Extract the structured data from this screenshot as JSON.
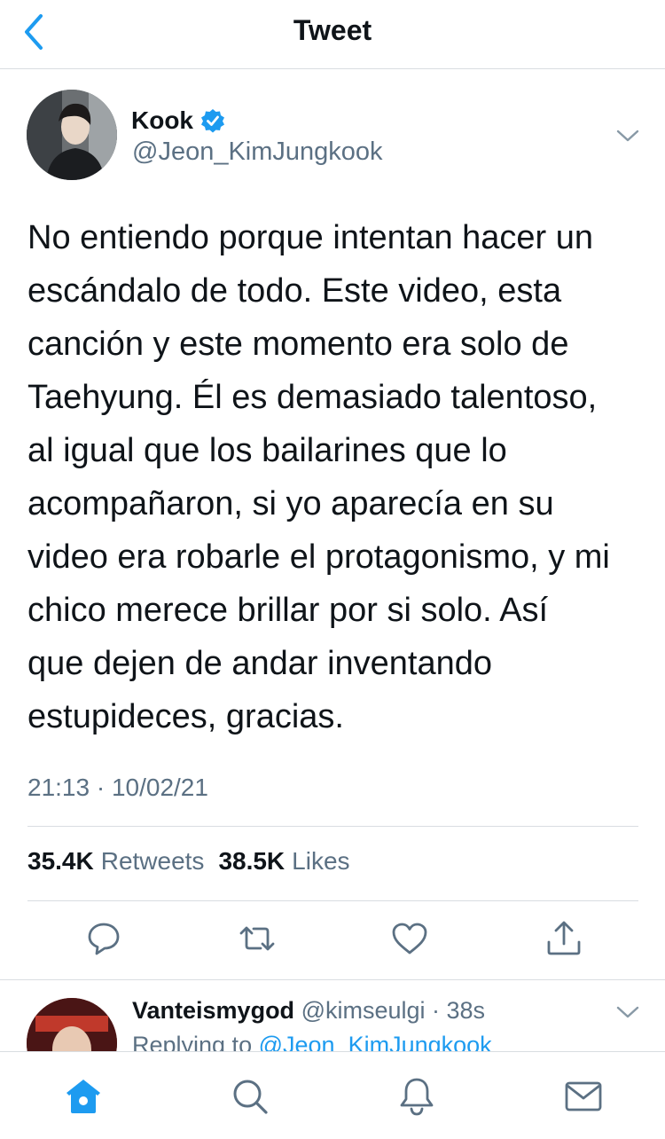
{
  "header": {
    "title": "Tweet"
  },
  "tweet": {
    "author_name": "Kook",
    "author_handle": "@Jeon_KimJungkook",
    "lines": [
      "No entiendo porque intentan hacer un",
      "escándalo de todo. Este video, esta",
      "canción y este momento era solo de",
      "Taehyung. Él es demasiado talentoso,",
      "al igual que los bailarines que lo",
      "acompañaron, si yo aparecía en su",
      "video era robarle el protagonismo, y mi",
      "chico merece brillar por si solo. Así",
      "que dejen de andar inventando",
      "estupideces, gracias."
    ],
    "timestamp": "21:13 · 10/02/21",
    "retweets_count": "35.4K",
    "retweets_label": "Retweets",
    "likes_count": "38.5K",
    "likes_label": "Likes"
  },
  "reply": {
    "name": "Vanteismygod",
    "handle_time": "@kimseulgi · 38s",
    "replying_prefix": "Replying to",
    "replying_mention": "@Jeon_KimJungkook"
  },
  "colors": {
    "accent": "#1d9bf0",
    "muted": "#5b7083",
    "text": "#0f1419",
    "divider": "#d9dde1"
  },
  "icons": [
    "back-arrow-icon",
    "verified-badge-icon",
    "chevron-down-icon",
    "reply-icon",
    "retweet-icon",
    "like-icon",
    "share-icon",
    "home-icon",
    "search-icon",
    "notifications-icon",
    "messages-icon"
  ]
}
